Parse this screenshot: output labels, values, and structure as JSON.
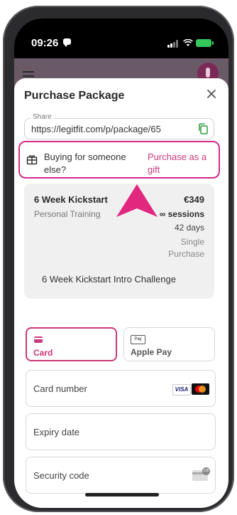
{
  "status_bar": {
    "time": "09:26"
  },
  "modal": {
    "title": "Purchase Package"
  },
  "share": {
    "label": "Share",
    "url": "https://legitfit.com/p/package/65"
  },
  "gift": {
    "question": "Buying for someone else?",
    "link": "Purchase as a gift"
  },
  "package": {
    "name": "6 Week Kickstart",
    "type": "Personal Training",
    "price": "€349",
    "sessions": "∞ sessions",
    "duration": "42 days",
    "purchase_type": "Single Purchase",
    "description": "6 Week Kickstart Intro Challenge"
  },
  "payment": {
    "tabs": [
      {
        "label": "Card",
        "selected": true
      },
      {
        "label": "Apple Pay",
        "selected": false
      }
    ],
    "applepay_icon_text": "Pay",
    "fields": [
      {
        "label": "Card number"
      },
      {
        "label": "Expiry date"
      },
      {
        "label": "Security code"
      }
    ],
    "brand_visa": "VISA"
  },
  "colors": {
    "accent": "#c8397a",
    "highlight_border": "#d62a8a",
    "arrow": "#e0287f"
  },
  "icons": [
    "message-icon",
    "signal-icon",
    "wifi-icon",
    "battery-icon",
    "menu-icon",
    "avatar",
    "close-icon",
    "copy-icon",
    "gift-icon",
    "card-icon",
    "apple-pay-icon",
    "visa-icon",
    "mastercard-icon",
    "cvc-icon",
    "arrow-pointer"
  ]
}
